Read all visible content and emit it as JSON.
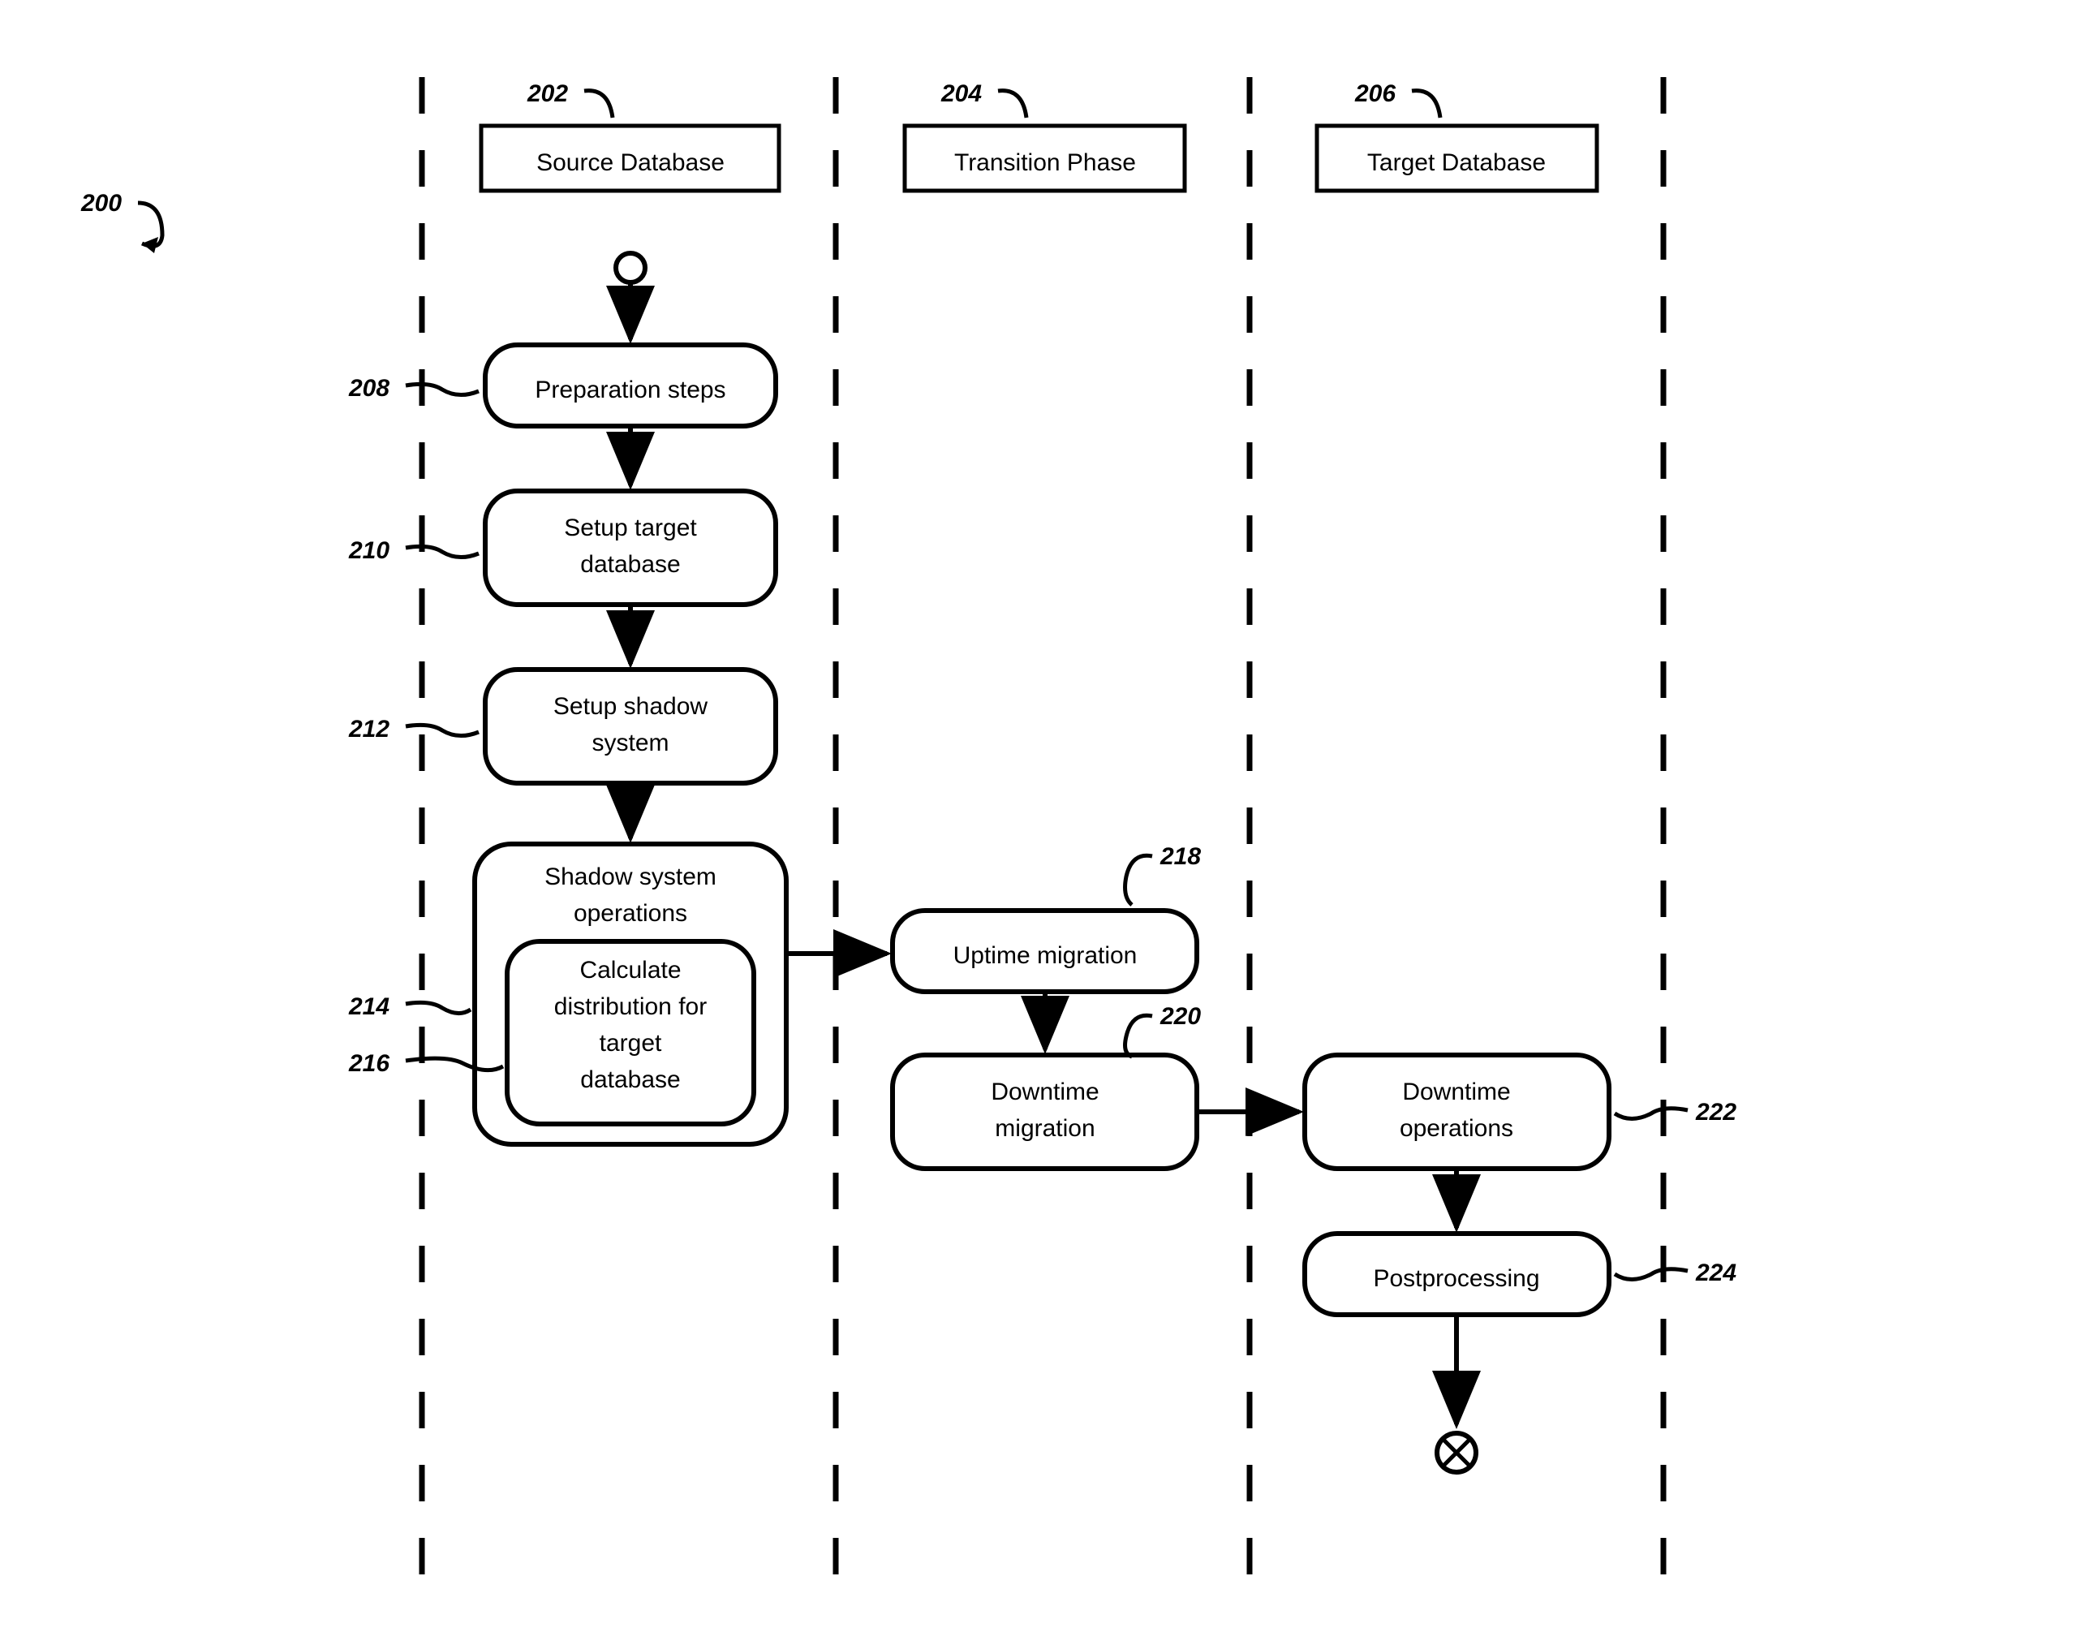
{
  "diagram_ref": "200",
  "lanes": {
    "source": {
      "ref": "202",
      "title": "Source Database"
    },
    "transition": {
      "ref": "204",
      "title": "Transition Phase"
    },
    "target": {
      "ref": "206",
      "title": "Target Database"
    }
  },
  "nodes": {
    "prep": {
      "ref": "208",
      "text": "Preparation steps"
    },
    "setup_target": {
      "ref": "210",
      "line1": "Setup target",
      "line2": "database"
    },
    "setup_shadow": {
      "ref": "212",
      "line1": "Setup shadow",
      "line2": "system"
    },
    "shadow_ops": {
      "ref": "214",
      "line1": "Shadow system",
      "line2": "operations"
    },
    "calc_dist": {
      "ref": "216",
      "line1": "Calculate",
      "line2": "distribution for",
      "line3": "target",
      "line4": "database"
    },
    "uptime": {
      "ref": "218",
      "text": "Uptime migration"
    },
    "downtime_mig": {
      "ref": "220",
      "line1": "Downtime",
      "line2": "migration"
    },
    "downtime_ops": {
      "ref": "222",
      "line1": "Downtime",
      "line2": "operations"
    },
    "postproc": {
      "ref": "224",
      "text": "Postprocessing"
    }
  }
}
